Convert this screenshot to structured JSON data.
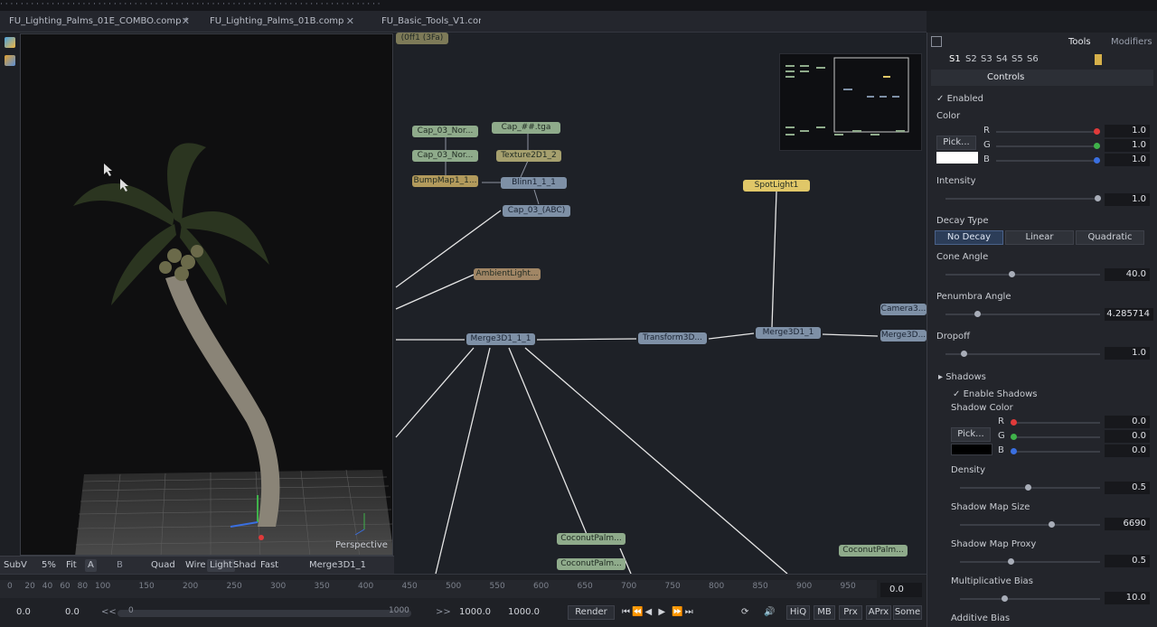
{
  "top_strip": "· · · · · · · · · · · · · · · · · · · · · · · · · · · · · · · · · · · · · · · · · · · · · · · · · · · · · · · · · · · · · · · · · · · · · · · · · ·",
  "tabs": [
    {
      "label": "FU_Lighting_Palms_01E_COMBO.comp *"
    },
    {
      "label": "FU_Lighting_Palms_01B.comp"
    },
    {
      "label": "FU_Basic_Tools_V1.com"
    }
  ],
  "tab_close": "✕",
  "viewer": {
    "label": "Perspective",
    "bar": {
      "subv": "SubV",
      "zoom": "5%",
      "fit": "Fit",
      "a": "A",
      "b": "B",
      "quad": "Quad",
      "wire": "Wire",
      "light": "Light",
      "shad": "Shad",
      "fast": "Fast",
      "node_name": "Merge3D1_1"
    }
  },
  "nodes": {
    "top_clip": "(0ff1 (3Fa)",
    "cap_nor_1": "Cap_03_Nor...",
    "cap_nor_2": "Cap_03_Nor...",
    "cap_tga": "Cap_##.tga",
    "texture": "Texture2D1_2",
    "bumpmap": "BumpMap1_1...",
    "blinn": "Blinn1_1_1",
    "cap_abc": "Cap_03_(ABC)",
    "spotlight": "SpotLight1",
    "ambient": "AmbientLight...",
    "merge3d_main": "Merge3D1_1_1",
    "transform": "Transform3D...",
    "merge3d_1": "Merge3D1_1",
    "camera": "Camera3...",
    "merge3d_right": "Merge3D...",
    "coconut_1": "CoconutPalm...",
    "coconut_2": "CoconutPalm...",
    "coconut_3": "CoconutPalm..."
  },
  "inspector": {
    "tab_tools": "Tools",
    "tab_modifiers": "Modifiers",
    "scenes": [
      "S1",
      "S2",
      "S3",
      "S4",
      "S5",
      "S6"
    ],
    "section": "Controls",
    "enabled": "Enabled",
    "color_label": "Color",
    "pick": "Pick...",
    "r_label": "R",
    "g_label": "G",
    "b_label": "B",
    "color_r": "1.0",
    "color_g": "1.0",
    "color_b": "1.0",
    "intensity_label": "Intensity",
    "intensity": "1.0",
    "decay_label": "Decay Type",
    "decay_options": [
      "No Decay",
      "Linear",
      "Quadratic"
    ],
    "cone_label": "Cone Angle",
    "cone": "40.0",
    "penumbra_label": "Penumbra Angle",
    "penumbra": "4.285714",
    "dropoff_label": "Dropoff",
    "dropoff": "1.0",
    "shadows_label": "Shadows",
    "enable_shadows": "Enable Shadows",
    "shadow_color_label": "Shadow Color",
    "shadow_r": "0.0",
    "shadow_g": "0.0",
    "shadow_b": "0.0",
    "density_label": "Density",
    "density": "0.5",
    "map_size_label": "Shadow Map Size",
    "map_size": "6690",
    "map_proxy_label": "Shadow Map Proxy",
    "map_proxy": "0.5",
    "mult_bias_label": "Multiplicative Bias",
    "mult_bias": "10.0",
    "add_bias_label": "Additive Bias",
    "colors": {
      "red": "#e03a3a",
      "green": "#3fb24a",
      "blue": "#3a6fe0"
    }
  },
  "timeline": {
    "ticks": [
      "0",
      "20",
      "40",
      "60",
      "80",
      "100",
      "150",
      "200",
      "250",
      "300",
      "350",
      "400",
      "450",
      "500",
      "550",
      "600",
      "650",
      "700",
      "750",
      "800",
      "850",
      "900",
      "950"
    ],
    "current": "0.0",
    "start": "0.0",
    "start2": "0.0",
    "range_start": "0",
    "range_end": "1000",
    "end": "1000.0",
    "end2": "1000.0",
    "render": "Render",
    "hiq": "HiQ",
    "mb": "MB",
    "prx": "Prx",
    "aprx": "APrx",
    "some": "Some"
  }
}
